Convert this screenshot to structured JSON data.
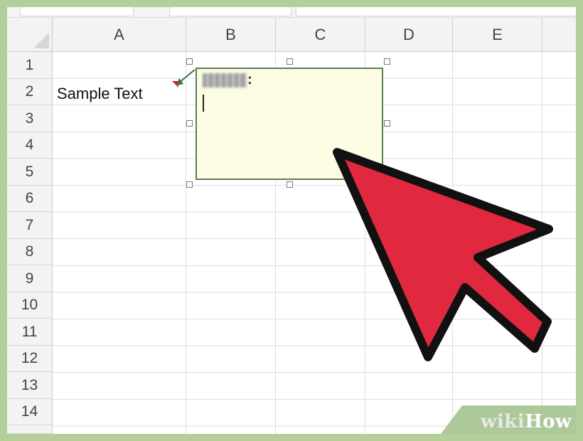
{
  "spreadsheet": {
    "columns": [
      "A",
      "B",
      "C",
      "D",
      "E"
    ],
    "rows": [
      "1",
      "2",
      "3",
      "4",
      "5",
      "6",
      "7",
      "8",
      "9",
      "10",
      "11",
      "12",
      "13",
      "14"
    ]
  },
  "cells": {
    "a2": "Sample Text"
  },
  "comment": {
    "author_suffix": ":"
  },
  "pointer": {
    "fill_color": "#e0293f",
    "icon": "cursor-arrow-icon"
  },
  "watermark": {
    "part1": "wiki",
    "part2": "How"
  },
  "colors": {
    "frame": "#b4cf9a",
    "comment_bg": "#fdfde4",
    "comment_indicator": "#d42020"
  }
}
